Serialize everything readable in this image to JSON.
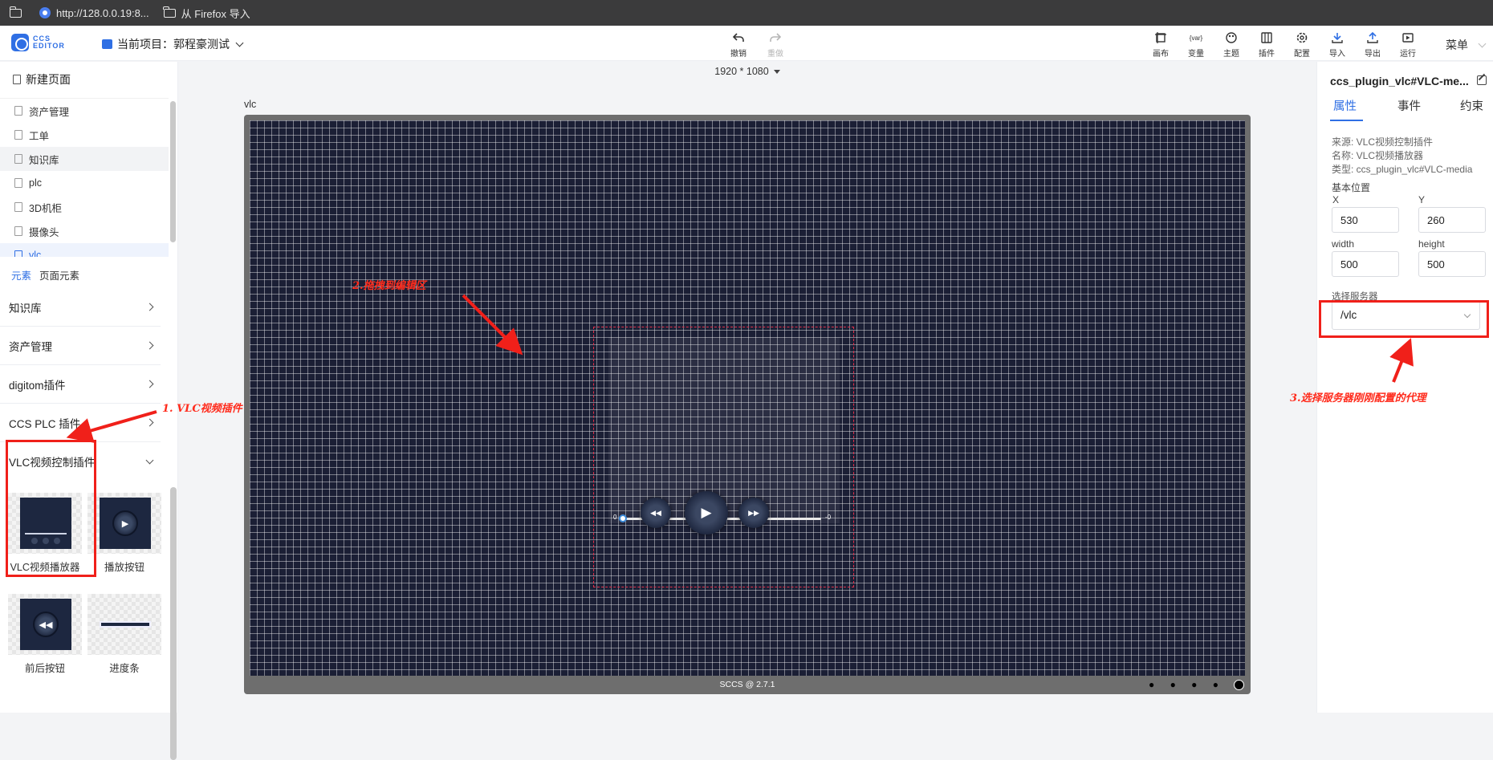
{
  "browser": {
    "bookmark_url": "http://128.0.0.19:8...",
    "bookmark_import": "从 Firefox 导入"
  },
  "header": {
    "logo_line1": "CCS",
    "logo_line2": "EDITOR",
    "project_label": "当前项目：郭程豪测试",
    "undo": "撤销",
    "redo": "重做",
    "toolbar": [
      {
        "label": "画布",
        "icon": "canvas-icon"
      },
      {
        "label": "变量",
        "icon": "variable-icon"
      },
      {
        "label": "主题",
        "icon": "theme-icon"
      },
      {
        "label": "插件",
        "icon": "plugin-icon"
      },
      {
        "label": "配置",
        "icon": "config-icon"
      },
      {
        "label": "导入",
        "icon": "import-icon"
      },
      {
        "label": "导出",
        "icon": "export-icon"
      },
      {
        "label": "运行",
        "icon": "run-icon"
      }
    ],
    "menu": "菜单"
  },
  "left": {
    "new_page": "新建页面",
    "pages": [
      "资产管理",
      "工单",
      "知识库",
      "plc",
      "3D机柜",
      "摄像头",
      "vlc"
    ],
    "tabs": [
      "元素",
      "页面元素"
    ],
    "categories": [
      "知识库",
      "资产管理",
      "digitom插件",
      "CCS PLC 插件",
      "VLC视频控制插件"
    ],
    "components": [
      "VLC视频播放器",
      "播放按钮",
      "前后按钮",
      "进度条"
    ]
  },
  "canvas": {
    "resolution": "1920 * 1080",
    "page_name": "vlc",
    "footer": "SCCS @ 2.7.1",
    "footer_dots": "● ● ● ●",
    "progress_start": "0",
    "progress_end": "-0",
    "progress_fraction": 0.0
  },
  "annotations": {
    "step1": "1. VLC视频插件",
    "step2": "2.拖拽到编辑区",
    "step3": "3.选择服务器刚刚配置的代理",
    "color": "#ff2b1c"
  },
  "right": {
    "component_title": "ccs_plugin_vlc#VLC-me...",
    "tabs": [
      "属性",
      "事件",
      "约束"
    ],
    "source": "来源: VLC视频控制插件",
    "name": "名称: VLC视频播放器",
    "type": "类型: ccs_plugin_vlc#VLC-media",
    "base_position": "基本位置",
    "x_label": "X",
    "y_label": "Y",
    "x_value": "530",
    "y_value": "260",
    "width_label": "width",
    "height_label": "height",
    "width_value": "500",
    "height_value": "500",
    "server_label": "选择服务器",
    "server_value": "/vlc"
  },
  "colors": {
    "accent": "#2f6fe4",
    "canvas_bg": "#1b1f35",
    "annotation_red": "#f0201a"
  }
}
